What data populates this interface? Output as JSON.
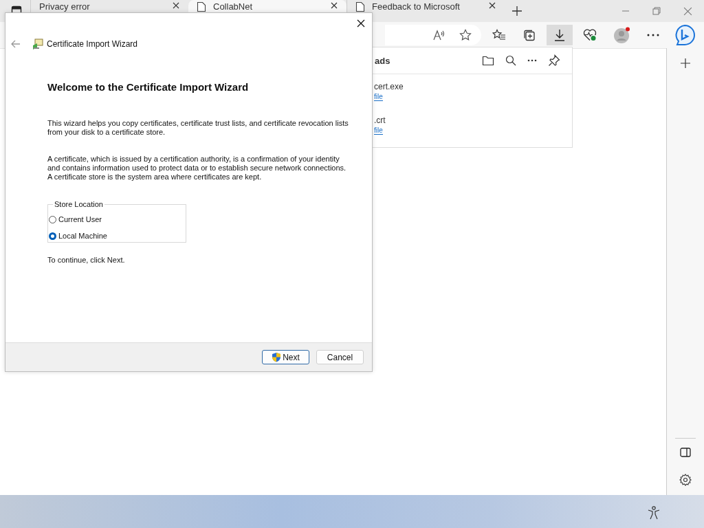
{
  "browser": {
    "tabs": [
      {
        "title": "Privacy error",
        "selected": false
      },
      {
        "title": "CollabNet",
        "selected": true
      },
      {
        "title": "Feedback to Microsoft",
        "selected": false
      }
    ],
    "downloads": {
      "heading": "ads",
      "items": [
        {
          "name": "cert.exe",
          "link": "file"
        },
        {
          "name": ".crt",
          "link": "file"
        }
      ]
    }
  },
  "wizard": {
    "title": "Certificate Import Wizard",
    "heading": "Welcome to the Certificate Import Wizard",
    "paragraphs": [
      "This wizard helps you copy certificates, certificate trust lists, and certificate revocation lists from your disk to a certificate store.",
      "A certificate, which is issued by a certification authority, is a confirmation of your identity and contains information used to protect data or to establish secure network connections. A certificate store is the system area where certificates are kept."
    ],
    "store_location": {
      "label": "Store Location",
      "options": [
        {
          "label": "Current User",
          "selected": false
        },
        {
          "label": "Local Machine",
          "selected": true
        }
      ]
    },
    "instruction": "To continue, click Next.",
    "buttons": [
      {
        "label": "Next",
        "kind": "primary"
      },
      {
        "label": "Cancel",
        "kind": "secondary"
      }
    ]
  }
}
